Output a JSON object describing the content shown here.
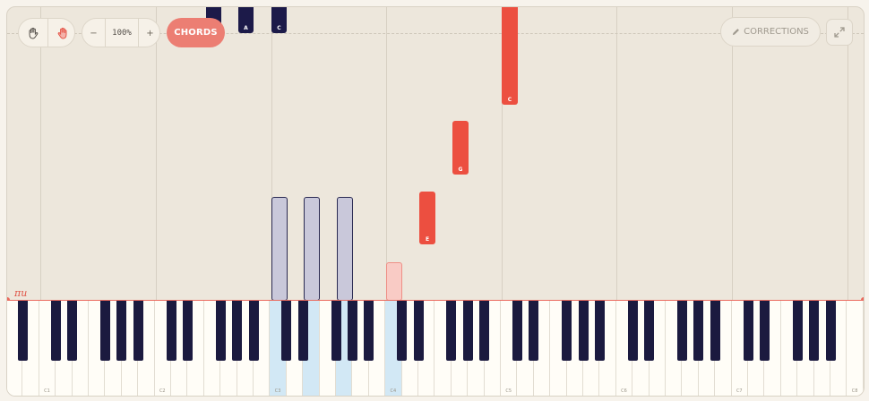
{
  "toolbar": {
    "left_hand_icon": "hand-icon",
    "right_hand_icon": "hand-icon",
    "zoom_minus": "−",
    "zoom_level": "100%",
    "zoom_plus": "+",
    "chords_label": "CHORDS",
    "corrections_label": "CORRECTIONS",
    "corrections_icon": "pencil-icon",
    "expand_icon": "expand-icon"
  },
  "hit_line_label": "πu",
  "notes": {
    "top_left": "",
    "a": "A",
    "c_top": "C",
    "c_high": "C",
    "g": "G",
    "e": "E"
  },
  "octave_labels": [
    "C1",
    "C2",
    "C3",
    "C4",
    "C5",
    "C6",
    "C7",
    "C8"
  ],
  "active_keys": [
    "C3",
    "E3",
    "G3",
    "C4"
  ],
  "colors": {
    "background": "#ede7dc",
    "accent": "#ec7e73",
    "falling_note_navy": "#1c1a49",
    "falling_note_red": "#ec4f40",
    "pressed_key": "#d2e8f5",
    "black_key": "#1b1a3f"
  }
}
